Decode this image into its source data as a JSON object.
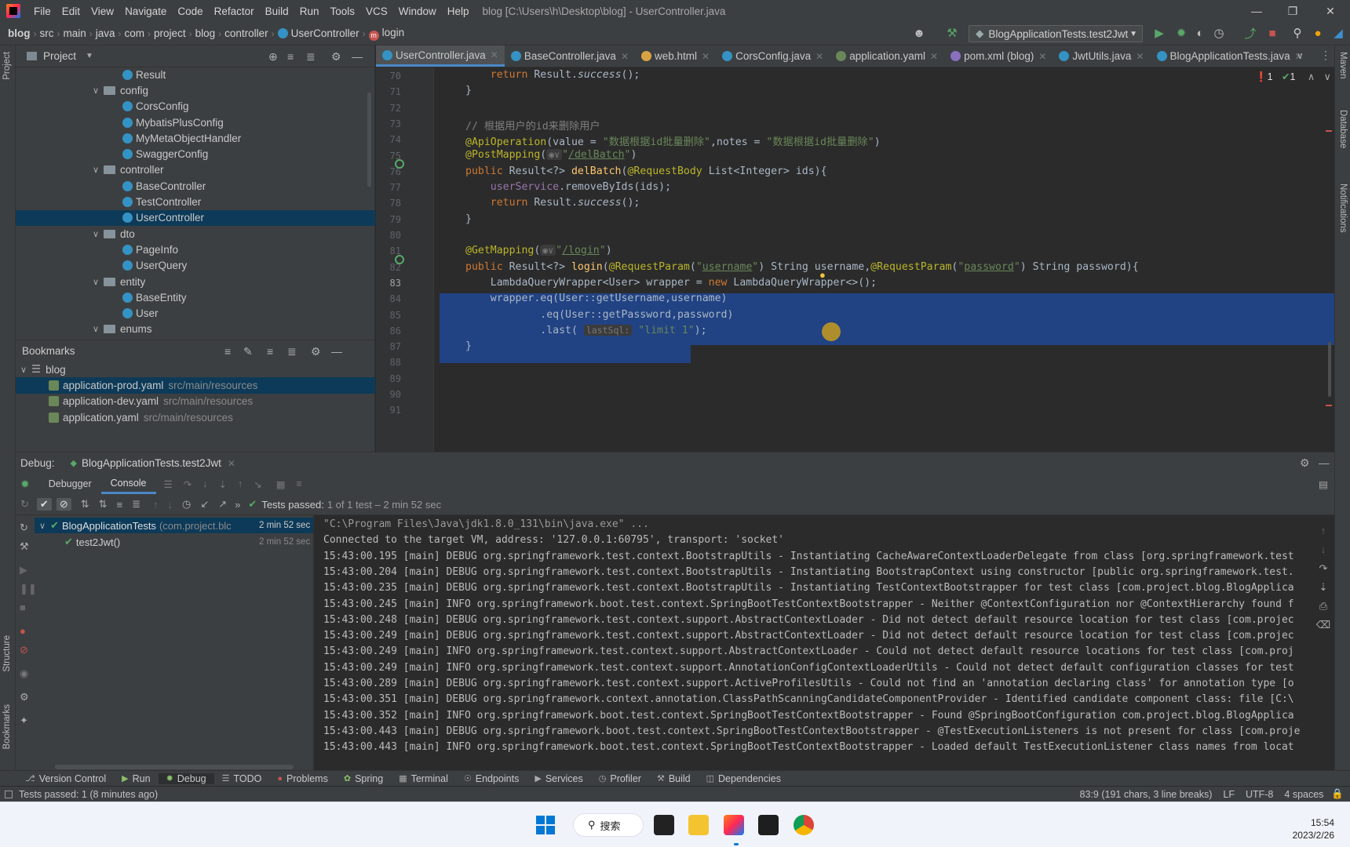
{
  "menubar": {
    "items": [
      "File",
      "Edit",
      "View",
      "Navigate",
      "Code",
      "Refactor",
      "Build",
      "Run",
      "Tools",
      "VCS",
      "Window",
      "Help"
    ],
    "title": "blog [C:\\Users\\h\\Desktop\\blog] - UserController.java"
  },
  "breadcrumb": {
    "items": [
      "blog",
      "src",
      "main",
      "java",
      "com",
      "project",
      "blog",
      "controller",
      "UserController",
      "login"
    ]
  },
  "run_config": {
    "label": "BlogApplicationTests.test2Jwt"
  },
  "project_panel": {
    "title": "Project",
    "tree": [
      {
        "label": "Result",
        "type": "class",
        "indent": 3
      },
      {
        "label": "config",
        "type": "folder",
        "indent": 2
      },
      {
        "label": "CorsConfig",
        "type": "class",
        "indent": 3
      },
      {
        "label": "MybatisPlusConfig",
        "type": "class",
        "indent": 3
      },
      {
        "label": "MyMetaObjectHandler",
        "type": "class",
        "indent": 3
      },
      {
        "label": "SwaggerConfig",
        "type": "class",
        "indent": 3
      },
      {
        "label": "controller",
        "type": "folder",
        "indent": 2
      },
      {
        "label": "BaseController",
        "type": "class",
        "indent": 3
      },
      {
        "label": "TestController",
        "type": "class",
        "indent": 3
      },
      {
        "label": "UserController",
        "type": "class",
        "indent": 3,
        "selected": true
      },
      {
        "label": "dto",
        "type": "folder",
        "indent": 2
      },
      {
        "label": "PageInfo",
        "type": "class",
        "indent": 3
      },
      {
        "label": "UserQuery",
        "type": "class",
        "indent": 3
      },
      {
        "label": "entity",
        "type": "folder",
        "indent": 2
      },
      {
        "label": "BaseEntity",
        "type": "class",
        "indent": 3
      },
      {
        "label": "User",
        "type": "class",
        "indent": 3
      },
      {
        "label": "enums",
        "type": "folder",
        "indent": 2
      }
    ]
  },
  "bookmarks": {
    "title": "Bookmarks",
    "root": "blog",
    "items": [
      {
        "file": "application-prod.yaml",
        "path": "src/main/resources",
        "selected": true
      },
      {
        "file": "application-dev.yaml",
        "path": "src/main/resources"
      },
      {
        "file": "application.yaml",
        "path": "src/main/resources"
      }
    ]
  },
  "editor_tabs": [
    {
      "label": "UserController.java",
      "active": true
    },
    {
      "label": "BaseController.java"
    },
    {
      "label": "web.html"
    },
    {
      "label": "CorsConfig.java"
    },
    {
      "label": "application.yaml"
    },
    {
      "label": "pom.xml (blog)"
    },
    {
      "label": "JwtUtils.java"
    },
    {
      "label": "BlogApplicationTests.java"
    }
  ],
  "inspections": {
    "errors": "1",
    "warnings": "1"
  },
  "line_numbers": [
    "70",
    "71",
    "72",
    "73",
    "74",
    "75",
    "76",
    "77",
    "78",
    "79",
    "80",
    "81",
    "82",
    "83",
    "84",
    "85",
    "86",
    "87",
    "88",
    "89",
    "90",
    "91"
  ],
  "current_line": "83",
  "debug": {
    "title": "Debug:",
    "session": "BlogApplicationTests.test2Jwt",
    "tabs": [
      "Debugger",
      "Console"
    ],
    "tests_passed": "Tests passed:",
    "tests_summary": "1 of 1 test – 2 min 52 sec",
    "test_tree": [
      {
        "label": "BlogApplicationTests",
        "pkg": "(com.project.blc",
        "time": "2 min 52 sec"
      },
      {
        "label": "test2Jwt()",
        "time": "2 min 52 sec"
      }
    ],
    "console": [
      "\"C:\\Program Files\\Java\\jdk1.8.0_131\\bin\\java.exe\" ...",
      "Connected to the target VM, address: '127.0.0.1:60795', transport: 'socket'",
      "15:43:00.195 [main] DEBUG org.springframework.test.context.BootstrapUtils - Instantiating CacheAwareContextLoaderDelegate from class [org.springframework.test",
      "15:43:00.204 [main] DEBUG org.springframework.test.context.BootstrapUtils - Instantiating BootstrapContext using constructor [public org.springframework.test.",
      "15:43:00.235 [main] DEBUG org.springframework.test.context.BootstrapUtils - Instantiating TestContextBootstrapper for test class [com.project.blog.BlogApplica",
      "15:43:00.245 [main] INFO org.springframework.boot.test.context.SpringBootTestContextBootstrapper - Neither @ContextConfiguration nor @ContextHierarchy found f",
      "15:43:00.248 [main] DEBUG org.springframework.test.context.support.AbstractContextLoader - Did not detect default resource location for test class [com.projec",
      "15:43:00.249 [main] DEBUG org.springframework.test.context.support.AbstractContextLoader - Did not detect default resource location for test class [com.projec",
      "15:43:00.249 [main] INFO org.springframework.test.context.support.AbstractContextLoader - Could not detect default resource locations for test class [com.proj",
      "15:43:00.249 [main] INFO org.springframework.test.context.support.AnnotationConfigContextLoaderUtils - Could not detect default configuration classes for test",
      "15:43:00.289 [main] DEBUG org.springframework.test.context.support.ActiveProfilesUtils - Could not find an 'annotation declaring class' for annotation type [o",
      "15:43:00.351 [main] DEBUG org.springframework.context.annotation.ClassPathScanningCandidateComponentProvider - Identified candidate component class: file [C:\\",
      "15:43:00.352 [main] INFO org.springframework.boot.test.context.SpringBootTestContextBootstrapper - Found @SpringBootConfiguration com.project.blog.BlogApplica",
      "15:43:00.443 [main] DEBUG org.springframework.boot.test.context.SpringBootTestContextBootstrapper - @TestExecutionListeners is not present for class [com.proje",
      "15:43:00.443 [main] INFO org.springframework.boot.test.context.SpringBootTestContextBootstrapper - Loaded default TestExecutionListener class names from locat"
    ]
  },
  "bottom_tools": [
    "Version Control",
    "Run",
    "Debug",
    "TODO",
    "Problems",
    "Spring",
    "Terminal",
    "Endpoints",
    "Services",
    "Profiler",
    "Build",
    "Dependencies"
  ],
  "status": {
    "message": "Tests passed: 1 (8 minutes ago)",
    "position": "83:9 (191 chars, 3 line breaks)",
    "line_sep": "LF",
    "encoding": "UTF-8",
    "indent": "4 spaces"
  },
  "side_labels": {
    "project": "Project",
    "structure": "Structure",
    "bookmarks": "Bookmarks",
    "maven": "Maven",
    "database": "Database",
    "notifications": "Notifications"
  },
  "taskbar": {
    "search": "搜索",
    "time": "15:54",
    "date": "2023/2/26"
  }
}
